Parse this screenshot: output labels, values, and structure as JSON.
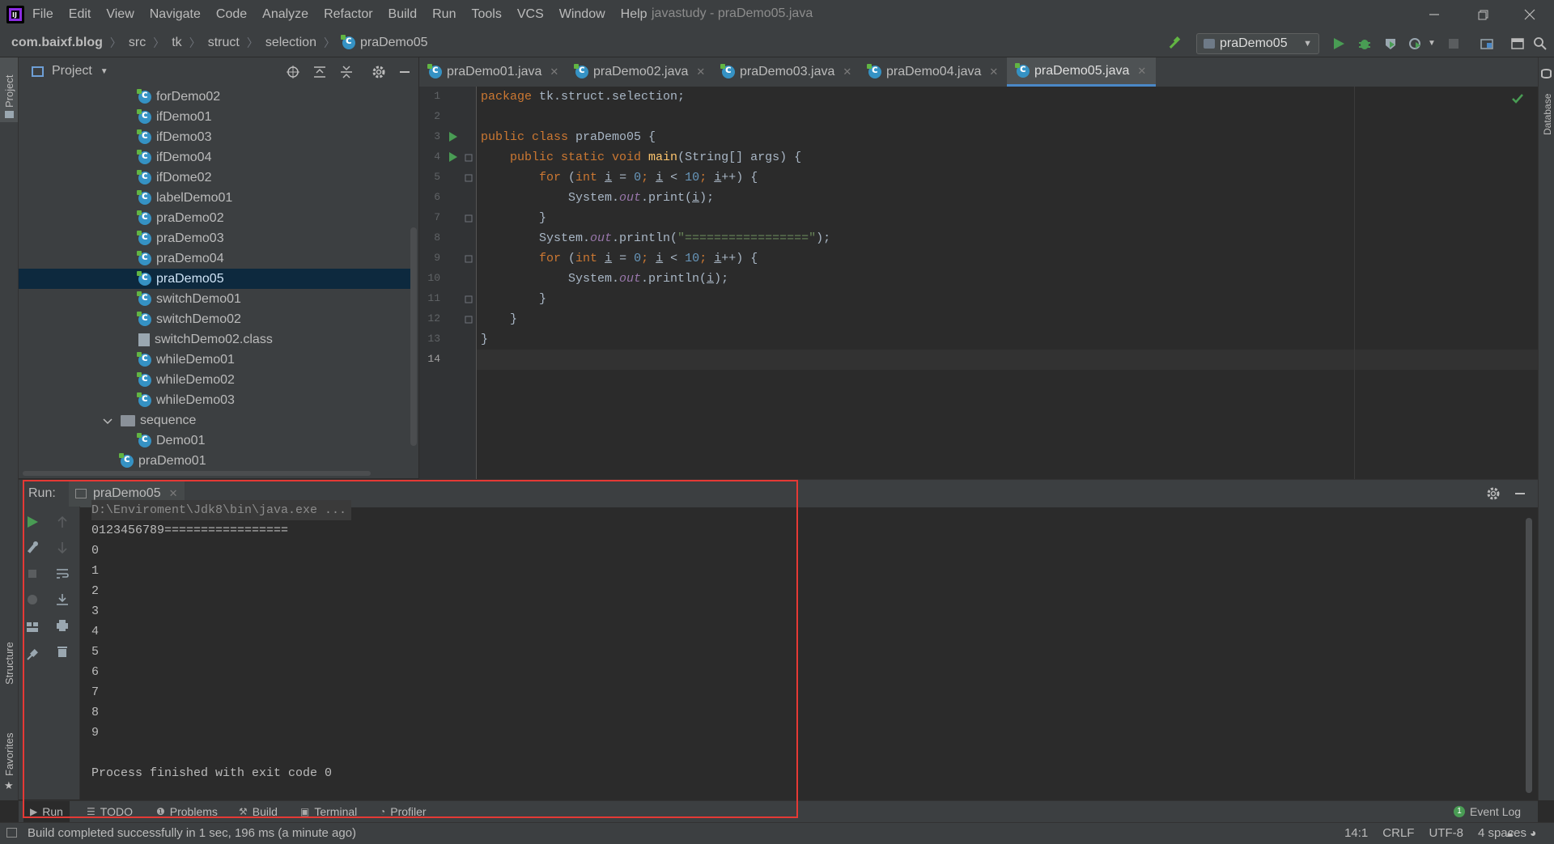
{
  "menubar": {
    "items": [
      "File",
      "Edit",
      "View",
      "Navigate",
      "Code",
      "Analyze",
      "Refactor",
      "Build",
      "Run",
      "Tools",
      "VCS",
      "Window",
      "Help"
    ],
    "window_title": "javastudy - praDemo05.java"
  },
  "breadcrumb": [
    "com.baixf.blog",
    "src",
    "tk",
    "struct",
    "selection",
    "praDemo05"
  ],
  "run_config": "praDemo05",
  "project_panel": {
    "title": "Project",
    "tree": [
      {
        "label": "forDemo02",
        "type": "class"
      },
      {
        "label": "ifDemo01",
        "type": "class"
      },
      {
        "label": "ifDemo03",
        "type": "class"
      },
      {
        "label": "ifDemo04",
        "type": "class"
      },
      {
        "label": "ifDome02",
        "type": "class"
      },
      {
        "label": "labelDemo01",
        "type": "class"
      },
      {
        "label": "praDemo02",
        "type": "class"
      },
      {
        "label": "praDemo03",
        "type": "class"
      },
      {
        "label": "praDemo04",
        "type": "class"
      },
      {
        "label": "praDemo05",
        "type": "class",
        "selected": true
      },
      {
        "label": "switchDemo01",
        "type": "class"
      },
      {
        "label": "switchDemo02",
        "type": "class"
      },
      {
        "label": "switchDemo02.class",
        "type": "file"
      },
      {
        "label": "whileDemo01",
        "type": "class"
      },
      {
        "label": "whileDemo02",
        "type": "class"
      },
      {
        "label": "whileDemo03",
        "type": "class"
      },
      {
        "label": "sequence",
        "type": "folder",
        "expanded": true
      },
      {
        "label": "Demo01",
        "type": "class"
      },
      {
        "label": "praDemo01",
        "type": "class"
      }
    ]
  },
  "editor": {
    "tabs": [
      {
        "label": "praDemo01.java"
      },
      {
        "label": "praDemo02.java"
      },
      {
        "label": "praDemo03.java"
      },
      {
        "label": "praDemo04.java"
      },
      {
        "label": "praDemo05.java",
        "active": true
      }
    ],
    "line_numbers": [
      "1",
      "2",
      "3",
      "4",
      "5",
      "6",
      "7",
      "8",
      "9",
      "10",
      "11",
      "12",
      "13",
      "14"
    ],
    "code": {
      "l1_kw": "package",
      "l1_rest": " tk.struct.selection;",
      "l3_kw": "public class",
      "l3_rest": " praDemo05 {",
      "l4_kw": "public static void",
      "l4_method": "main",
      "l4_rest": "(String[] args) {",
      "for_kw": "for",
      "int_kw": "int",
      "loop_var": "i",
      "zero": "0",
      "ten": "10",
      "l6_a": "System.",
      "out": "out",
      "l6_b": ".print(",
      "l8_b": ".println(",
      "l8_str": "\"=================\"",
      "l6_end": ");",
      "close_brace": "}"
    }
  },
  "run_panel": {
    "label": "Run:",
    "tab": "praDemo05",
    "console": [
      "D:\\Enviroment\\Jdk8\\bin\\java.exe ...",
      "0123456789=================",
      "0",
      "1",
      "2",
      "3",
      "4",
      "5",
      "6",
      "7",
      "8",
      "9",
      "",
      "Process finished with exit code 0"
    ]
  },
  "toolwindows": [
    {
      "label": "Run",
      "active": true
    },
    {
      "label": "TODO"
    },
    {
      "label": "Problems"
    },
    {
      "label": "Build"
    },
    {
      "label": "Terminal"
    },
    {
      "label": "Profiler"
    }
  ],
  "event_log": {
    "label": "Event Log",
    "count": "1"
  },
  "side_labels": {
    "project": "Project",
    "structure": "Structure",
    "favorites": "Favorites",
    "database": "Database"
  },
  "statusbar": {
    "message": "Build completed successfully in 1 sec, 196 ms (a minute ago)",
    "position": "14:1",
    "line_sep": "CRLF",
    "encoding": "UTF-8",
    "indent": "4 spaces"
  },
  "colors": {
    "accent": "#4a88c7",
    "highlight_box": "#e53935",
    "run_green": "#499c54"
  }
}
